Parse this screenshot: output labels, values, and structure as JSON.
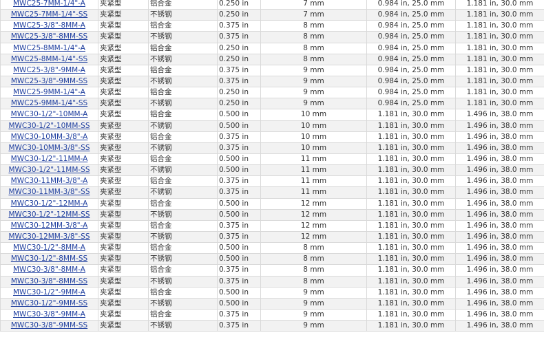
{
  "rows": [
    [
      "MWC25-7MM-1/4\"-A",
      "夹紧型",
      "铝合金",
      "0.250 in",
      "7 mm",
      "0.984 in, 25.0 mm",
      "1.181 in, 30.0 mm"
    ],
    [
      "MWC25-7MM-1/4\"-SS",
      "夹紧型",
      "不锈钢",
      "0.250 in",
      "7 mm",
      "0.984 in, 25.0 mm",
      "1.181 in, 30.0 mm"
    ],
    [
      "MWC25-3/8\"-8MM-A",
      "夹紧型",
      "铝合金",
      "0.375 in",
      "8 mm",
      "0.984 in, 25.0 mm",
      "1.181 in, 30.0 mm"
    ],
    [
      "MWC25-3/8\"-8MM-SS",
      "夹紧型",
      "不锈钢",
      "0.375 in",
      "8 mm",
      "0.984 in, 25.0 mm",
      "1.181 in, 30.0 mm"
    ],
    [
      "MWC25-8MM-1/4\"-A",
      "夹紧型",
      "铝合金",
      "0.250 in",
      "8 mm",
      "0.984 in, 25.0 mm",
      "1.181 in, 30.0 mm"
    ],
    [
      "MWC25-8MM-1/4\"-SS",
      "夹紧型",
      "不锈钢",
      "0.250 in",
      "8 mm",
      "0.984 in, 25.0 mm",
      "1.181 in, 30.0 mm"
    ],
    [
      "MWC25-3/8\"-9MM-A",
      "夹紧型",
      "铝合金",
      "0.375 in",
      "9 mm",
      "0.984 in, 25.0 mm",
      "1.181 in, 30.0 mm"
    ],
    [
      "MWC25-3/8\"-9MM-SS",
      "夹紧型",
      "不锈钢",
      "0.375 in",
      "9 mm",
      "0.984 in, 25.0 mm",
      "1.181 in, 30.0 mm"
    ],
    [
      "MWC25-9MM-1/4\"-A",
      "夹紧型",
      "铝合金",
      "0.250 in",
      "9 mm",
      "0.984 in, 25.0 mm",
      "1.181 in, 30.0 mm"
    ],
    [
      "MWC25-9MM-1/4\"-SS",
      "夹紧型",
      "不锈钢",
      "0.250 in",
      "9 mm",
      "0.984 in, 25.0 mm",
      "1.181 in, 30.0 mm"
    ],
    [
      "MWC30-1/2\"-10MM-A",
      "夹紧型",
      "铝合金",
      "0.500 in",
      "10 mm",
      "1.181 in, 30.0 mm",
      "1.496 in, 38.0 mm"
    ],
    [
      "MWC30-1/2\"-10MM-SS",
      "夹紧型",
      "不锈钢",
      "0.500 in",
      "10 mm",
      "1.181 in, 30.0 mm",
      "1.496 in, 38.0 mm"
    ],
    [
      "MWC30-10MM-3/8\"-A",
      "夹紧型",
      "铝合金",
      "0.375 in",
      "10 mm",
      "1.181 in, 30.0 mm",
      "1.496 in, 38.0 mm"
    ],
    [
      "MWC30-10MM-3/8\"-SS",
      "夹紧型",
      "不锈钢",
      "0.375 in",
      "10 mm",
      "1.181 in, 30.0 mm",
      "1.496 in, 38.0 mm"
    ],
    [
      "MWC30-1/2\"-11MM-A",
      "夹紧型",
      "铝合金",
      "0.500 in",
      "11 mm",
      "1.181 in, 30.0 mm",
      "1.496 in, 38.0 mm"
    ],
    [
      "MWC30-1/2\"-11MM-SS",
      "夹紧型",
      "不锈钢",
      "0.500 in",
      "11 mm",
      "1.181 in, 30.0 mm",
      "1.496 in, 38.0 mm"
    ],
    [
      "MWC30-11MM-3/8\"-A",
      "夹紧型",
      "铝合金",
      "0.375 in",
      "11 mm",
      "1.181 in, 30.0 mm",
      "1.496 in, 38.0 mm"
    ],
    [
      "MWC30-11MM-3/8\"-SS",
      "夹紧型",
      "不锈钢",
      "0.375 in",
      "11 mm",
      "1.181 in, 30.0 mm",
      "1.496 in, 38.0 mm"
    ],
    [
      "MWC30-1/2\"-12MM-A",
      "夹紧型",
      "铝合金",
      "0.500 in",
      "12 mm",
      "1.181 in, 30.0 mm",
      "1.496 in, 38.0 mm"
    ],
    [
      "MWC30-1/2\"-12MM-SS",
      "夹紧型",
      "不锈钢",
      "0.500 in",
      "12 mm",
      "1.181 in, 30.0 mm",
      "1.496 in, 38.0 mm"
    ],
    [
      "MWC30-12MM-3/8\"-A",
      "夹紧型",
      "铝合金",
      "0.375 in",
      "12 mm",
      "1.181 in, 30.0 mm",
      "1.496 in, 38.0 mm"
    ],
    [
      "MWC30-12MM-3/8\"-SS",
      "夹紧型",
      "不锈钢",
      "0.375 in",
      "12 mm",
      "1.181 in, 30.0 mm",
      "1.496 in, 38.0 mm"
    ],
    [
      "MWC30-1/2\"-8MM-A",
      "夹紧型",
      "铝合金",
      "0.500 in",
      "8 mm",
      "1.181 in, 30.0 mm",
      "1.496 in, 38.0 mm"
    ],
    [
      "MWC30-1/2\"-8MM-SS",
      "夹紧型",
      "不锈钢",
      "0.500 in",
      "8 mm",
      "1.181 in, 30.0 mm",
      "1.496 in, 38.0 mm"
    ],
    [
      "MWC30-3/8\"-8MM-A",
      "夹紧型",
      "铝合金",
      "0.375 in",
      "8 mm",
      "1.181 in, 30.0 mm",
      "1.496 in, 38.0 mm"
    ],
    [
      "MWC30-3/8\"-8MM-SS",
      "夹紧型",
      "不锈钢",
      "0.375 in",
      "8 mm",
      "1.181 in, 30.0 mm",
      "1.496 in, 38.0 mm"
    ],
    [
      "MWC30-1/2\"-9MM-A",
      "夹紧型",
      "铝合金",
      "0.500 in",
      "9 mm",
      "1.181 in, 30.0 mm",
      "1.496 in, 38.0 mm"
    ],
    [
      "MWC30-1/2\"-9MM-SS",
      "夹紧型",
      "不锈钢",
      "0.500 in",
      "9 mm",
      "1.181 in, 30.0 mm",
      "1.496 in, 38.0 mm"
    ],
    [
      "MWC30-3/8\"-9MM-A",
      "夹紧型",
      "铝合金",
      "0.375 in",
      "9 mm",
      "1.181 in, 30.0 mm",
      "1.496 in, 38.0 mm"
    ],
    [
      "MWC30-3/8\"-9MM-SS",
      "夹紧型",
      "不锈钢",
      "0.375 in",
      "9 mm",
      "1.181 in, 30.0 mm",
      "1.496 in, 38.0 mm"
    ]
  ],
  "colors": {
    "link": "#1f3f9f",
    "text": "#333333",
    "row_alt": "#f2f2f2",
    "border": "#d9d9d9"
  }
}
